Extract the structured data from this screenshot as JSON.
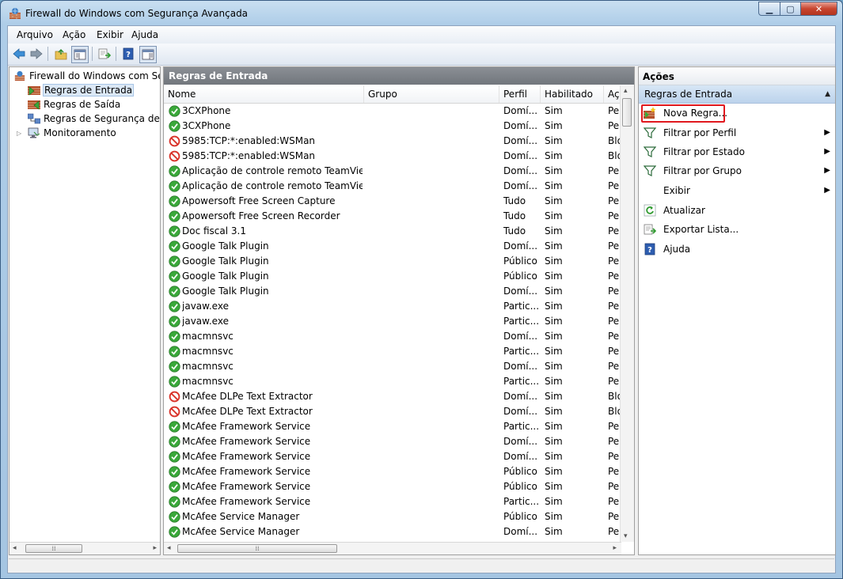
{
  "window": {
    "title": "Firewall do Windows com Segurança Avançada"
  },
  "menu": [
    "Arquivo",
    "Ação",
    "Exibir",
    "Ajuda"
  ],
  "tree": {
    "items": [
      {
        "label": "Firewall do Windows com Segu",
        "icon": "firewall-icon"
      },
      {
        "label": "Regras de Entrada",
        "icon": "inbound-rules-icon"
      },
      {
        "label": "Regras de Saída",
        "icon": "outbound-rules-icon"
      },
      {
        "label": "Regras de Segurança de Cor",
        "icon": "connection-security-icon"
      },
      {
        "label": "Monitoramento",
        "icon": "monitor-icon"
      }
    ]
  },
  "center": {
    "title": "Regras de Entrada",
    "columns": [
      "Nome",
      "Grupo",
      "Perfil",
      "Habilitado",
      "Açã"
    ],
    "rows": [
      {
        "status": "allow",
        "name": "3CXPhone",
        "group": "",
        "profile": "Domí...",
        "enabled": "Sim",
        "action": "Per"
      },
      {
        "status": "allow",
        "name": "3CXPhone",
        "group": "",
        "profile": "Domí...",
        "enabled": "Sim",
        "action": "Per"
      },
      {
        "status": "block",
        "name": "5985:TCP:*:enabled:WSMan",
        "group": "",
        "profile": "Domí...",
        "enabled": "Sim",
        "action": "Blo"
      },
      {
        "status": "block",
        "name": "5985:TCP:*:enabled:WSMan",
        "group": "",
        "profile": "Domí...",
        "enabled": "Sim",
        "action": "Blo"
      },
      {
        "status": "allow",
        "name": "Aplicação de controle remoto TeamViewer",
        "group": "",
        "profile": "Domí...",
        "enabled": "Sim",
        "action": "Per"
      },
      {
        "status": "allow",
        "name": "Aplicação de controle remoto TeamViewer",
        "group": "",
        "profile": "Domí...",
        "enabled": "Sim",
        "action": "Per"
      },
      {
        "status": "allow",
        "name": "Apowersoft Free Screen Capture",
        "group": "",
        "profile": "Tudo",
        "enabled": "Sim",
        "action": "Per"
      },
      {
        "status": "allow",
        "name": "Apowersoft Free Screen Recorder",
        "group": "",
        "profile": "Tudo",
        "enabled": "Sim",
        "action": "Per"
      },
      {
        "status": "allow",
        "name": "Doc fiscal 3.1",
        "group": "",
        "profile": "Tudo",
        "enabled": "Sim",
        "action": "Per"
      },
      {
        "status": "allow",
        "name": "Google Talk Plugin",
        "group": "",
        "profile": "Domí...",
        "enabled": "Sim",
        "action": "Per"
      },
      {
        "status": "allow",
        "name": "Google Talk Plugin",
        "group": "",
        "profile": "Público",
        "enabled": "Sim",
        "action": "Per"
      },
      {
        "status": "allow",
        "name": "Google Talk Plugin",
        "group": "",
        "profile": "Público",
        "enabled": "Sim",
        "action": "Per"
      },
      {
        "status": "allow",
        "name": "Google Talk Plugin",
        "group": "",
        "profile": "Domí...",
        "enabled": "Sim",
        "action": "Per"
      },
      {
        "status": "allow",
        "name": "javaw.exe",
        "group": "",
        "profile": "Partic...",
        "enabled": "Sim",
        "action": "Per"
      },
      {
        "status": "allow",
        "name": "javaw.exe",
        "group": "",
        "profile": "Partic...",
        "enabled": "Sim",
        "action": "Per"
      },
      {
        "status": "allow",
        "name": "macmnsvc",
        "group": "",
        "profile": "Domí...",
        "enabled": "Sim",
        "action": "Per"
      },
      {
        "status": "allow",
        "name": "macmnsvc",
        "group": "",
        "profile": "Partic...",
        "enabled": "Sim",
        "action": "Per"
      },
      {
        "status": "allow",
        "name": "macmnsvc",
        "group": "",
        "profile": "Domí...",
        "enabled": "Sim",
        "action": "Per"
      },
      {
        "status": "allow",
        "name": "macmnsvc",
        "group": "",
        "profile": "Partic...",
        "enabled": "Sim",
        "action": "Per"
      },
      {
        "status": "block",
        "name": "McAfee DLPe Text Extractor",
        "group": "",
        "profile": "Domí...",
        "enabled": "Sim",
        "action": "Blo"
      },
      {
        "status": "block",
        "name": "McAfee DLPe Text Extractor",
        "group": "",
        "profile": "Domí...",
        "enabled": "Sim",
        "action": "Blo"
      },
      {
        "status": "allow",
        "name": "McAfee Framework Service",
        "group": "",
        "profile": "Partic...",
        "enabled": "Sim",
        "action": "Per"
      },
      {
        "status": "allow",
        "name": "McAfee Framework Service",
        "group": "",
        "profile": "Domí...",
        "enabled": "Sim",
        "action": "Per"
      },
      {
        "status": "allow",
        "name": "McAfee Framework Service",
        "group": "",
        "profile": "Domí...",
        "enabled": "Sim",
        "action": "Per"
      },
      {
        "status": "allow",
        "name": "McAfee Framework Service",
        "group": "",
        "profile": "Público",
        "enabled": "Sim",
        "action": "Per"
      },
      {
        "status": "allow",
        "name": "McAfee Framework Service",
        "group": "",
        "profile": "Público",
        "enabled": "Sim",
        "action": "Per"
      },
      {
        "status": "allow",
        "name": "McAfee Framework Service",
        "group": "",
        "profile": "Partic...",
        "enabled": "Sim",
        "action": "Per"
      },
      {
        "status": "allow",
        "name": "McAfee Service Manager",
        "group": "",
        "profile": "Público",
        "enabled": "Sim",
        "action": "Per"
      },
      {
        "status": "allow",
        "name": "McAfee Service Manager",
        "group": "",
        "profile": "Domí...",
        "enabled": "Sim",
        "action": "Per"
      }
    ]
  },
  "actions": {
    "title": "Ações",
    "section": "Regras de Entrada",
    "items": [
      {
        "label": "Nova Regra...",
        "icon": "new-rule-icon",
        "submenu": false
      },
      {
        "label": "Filtrar por Perfil",
        "icon": "filter-icon",
        "submenu": true
      },
      {
        "label": "Filtrar por Estado",
        "icon": "filter-icon",
        "submenu": true
      },
      {
        "label": "Filtrar por Grupo",
        "icon": "filter-icon",
        "submenu": true
      },
      {
        "label": "Exibir",
        "icon": "",
        "submenu": true
      },
      {
        "label": "Atualizar",
        "icon": "refresh-icon",
        "submenu": false
      },
      {
        "label": "Exportar Lista...",
        "icon": "export-icon",
        "submenu": false
      },
      {
        "label": "Ajuda",
        "icon": "help-icon",
        "submenu": false
      }
    ]
  },
  "colors": {
    "allow": "#3aa83a",
    "block": "#d9342b",
    "highlight": "#e0181e"
  }
}
